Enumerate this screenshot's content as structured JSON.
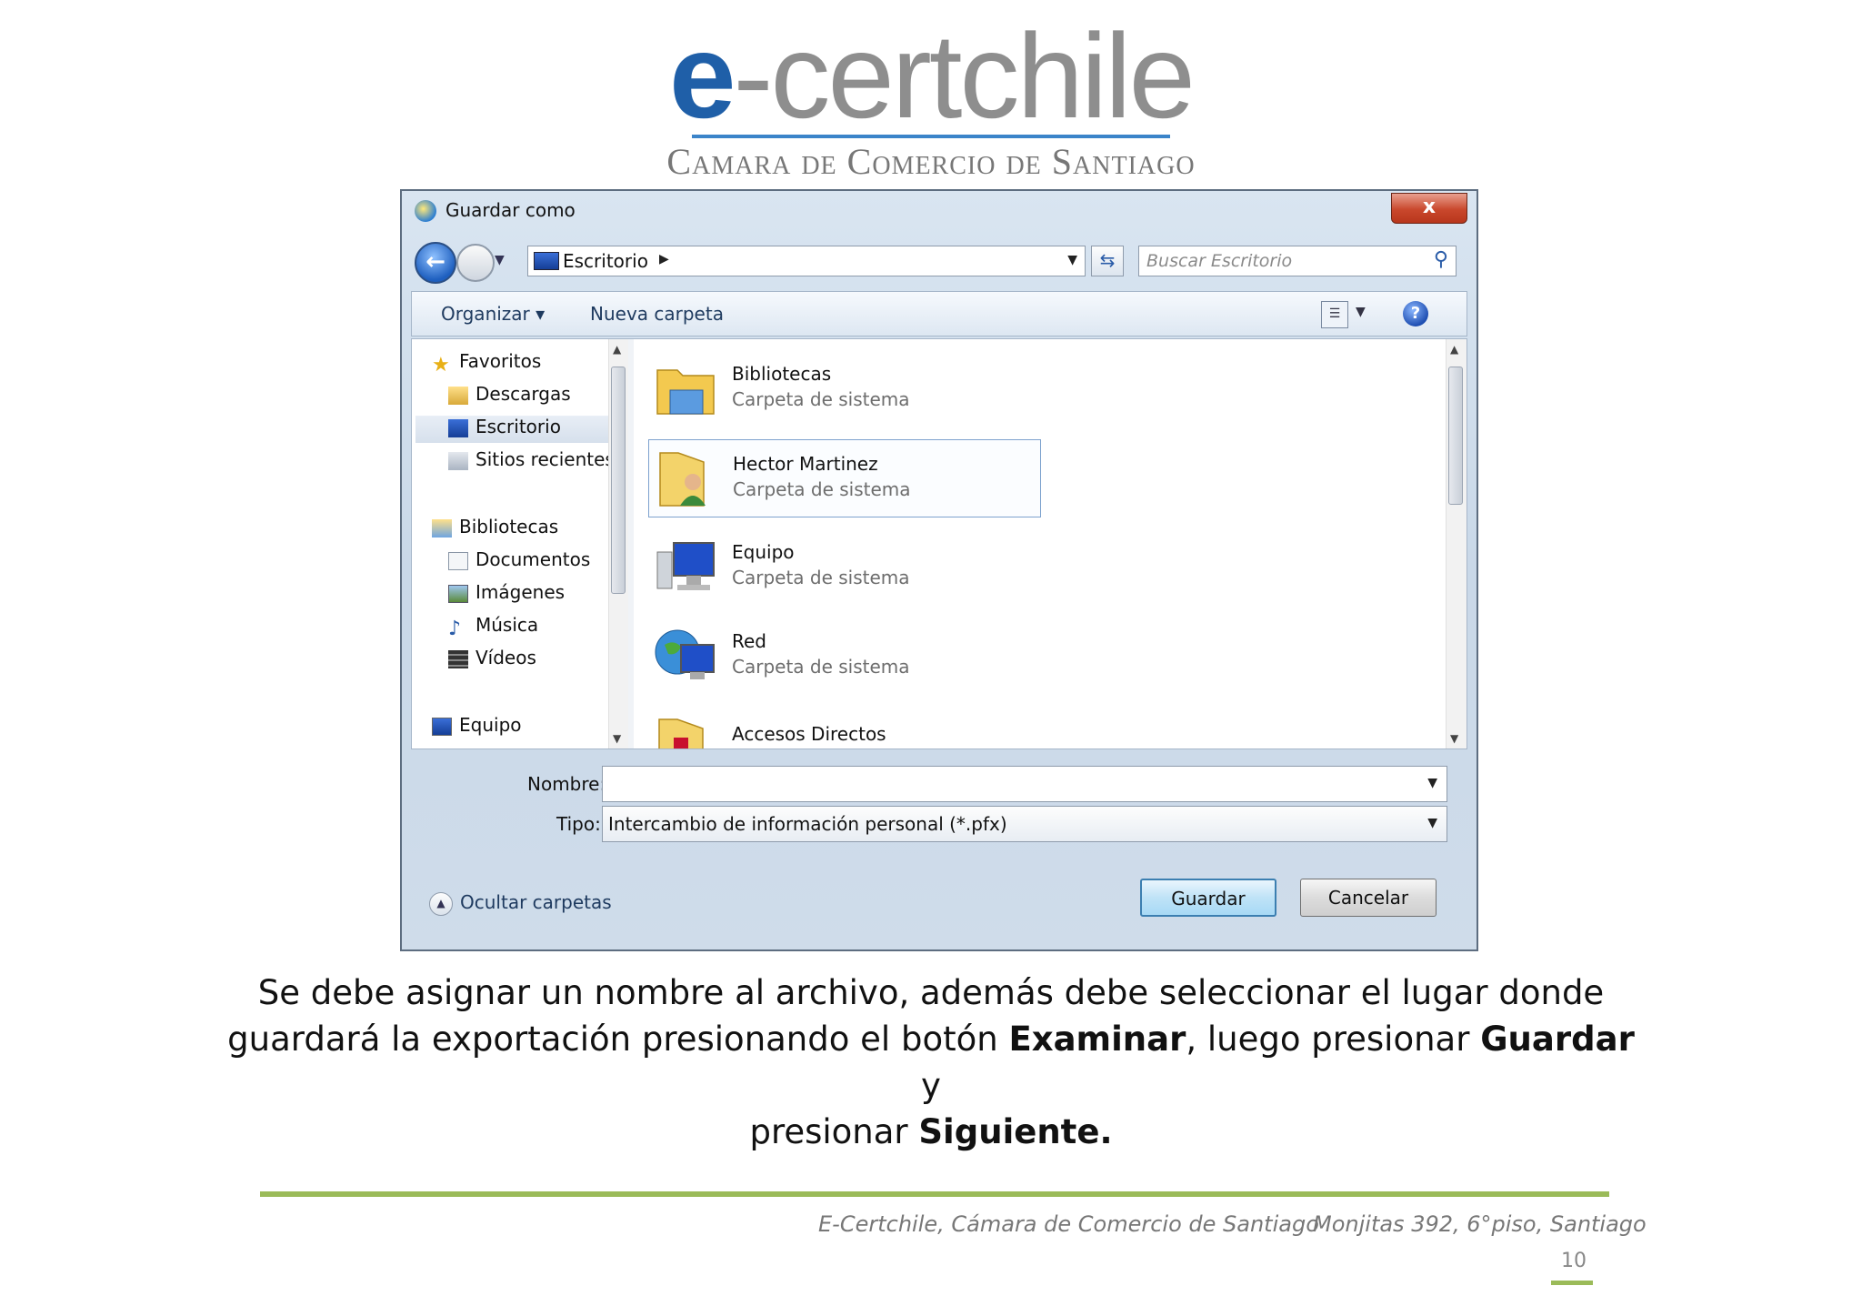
{
  "logo": {
    "word_prefix": "e",
    "word_rest": "-certchile",
    "subtitle": "Camara de Comercio de Santiago"
  },
  "dialog": {
    "title": "Guardar como",
    "close_label": "x",
    "address": {
      "current": "Escritorio"
    },
    "search": {
      "placeholder": "Buscar Escritorio"
    },
    "toolbar": {
      "organize": "Organizar",
      "new_folder": "Nueva carpeta"
    },
    "nav_items": [
      {
        "label": "Favoritos",
        "icon": "star-icon"
      },
      {
        "label": "Descargas",
        "icon": "downloads-icon"
      },
      {
        "label": "Escritorio",
        "icon": "desktop-icon",
        "selected": true
      },
      {
        "label": "Sitios recientes",
        "icon": "recent-places-icon"
      },
      {
        "label": "Bibliotecas",
        "icon": "libraries-icon"
      },
      {
        "label": "Documentos",
        "icon": "documents-icon"
      },
      {
        "label": "Imágenes",
        "icon": "pictures-icon"
      },
      {
        "label": "Música",
        "icon": "music-icon"
      },
      {
        "label": "Vídeos",
        "icon": "videos-icon"
      },
      {
        "label": "Equipo",
        "icon": "computer-icon"
      }
    ],
    "files": [
      {
        "name": "Bibliotecas",
        "type": "Carpeta de sistema",
        "icon": "libraries-folder-icon"
      },
      {
        "name": "Hector Martinez",
        "type": "Carpeta de sistema",
        "icon": "user-folder-icon"
      },
      {
        "name": "Equipo",
        "type": "Carpeta de sistema",
        "icon": "computer-icon"
      },
      {
        "name": "Red",
        "type": "Carpeta de sistema",
        "icon": "network-icon"
      },
      {
        "name": "Accesos Directos",
        "type": "",
        "icon": "shortcuts-folder-icon"
      }
    ],
    "form": {
      "name_label": "Nombre:",
      "name_value": "",
      "type_label": "Tipo:",
      "type_value": "Intercambio de información personal (*.pfx)"
    },
    "hide_folders": "Ocultar carpetas",
    "save_button": "Guardar",
    "cancel_button": "Cancelar"
  },
  "caption": {
    "line1": "Se debe asignar un nombre al archivo, además debe seleccionar el lugar donde",
    "line2_a": "guardará la exportación presionando el botón ",
    "line2_bold1": "Examinar",
    "line2_b": ", luego presionar ",
    "line2_bold2": "Guardar",
    "line2_c": " y",
    "line3_a": "presionar ",
    "line3_bold": "Siguiente."
  },
  "footer": {
    "left": "E-Certchile, Cámara de Comercio de Santiago",
    "right": "Monjitas 392, 6°piso, Santiago",
    "page": "10"
  },
  "colors": {
    "logo_blue": "#1f5fa8",
    "footer_green": "#9bbb59"
  }
}
